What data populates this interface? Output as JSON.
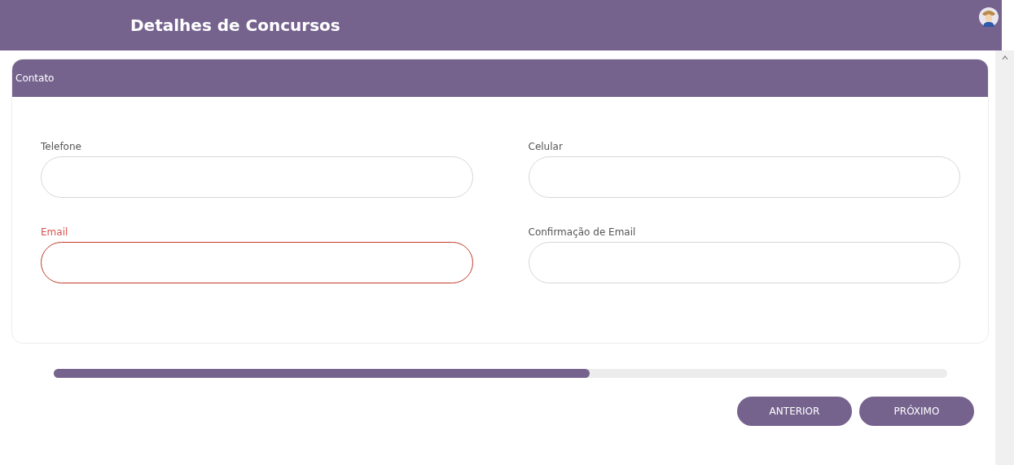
{
  "header": {
    "title": "Detalhes de Concursos"
  },
  "section": {
    "title": "Contato",
    "fields": [
      {
        "label": "Telefone",
        "invalid": false
      },
      {
        "label": "Celular",
        "invalid": false
      },
      {
        "label": "Email",
        "invalid": true
      },
      {
        "label": "Confirmação de Email",
        "invalid": false
      }
    ]
  },
  "progress": {
    "level": 0.6
  },
  "buttons": [
    "ANTERIOR",
    "PRÓXIMO"
  ]
}
